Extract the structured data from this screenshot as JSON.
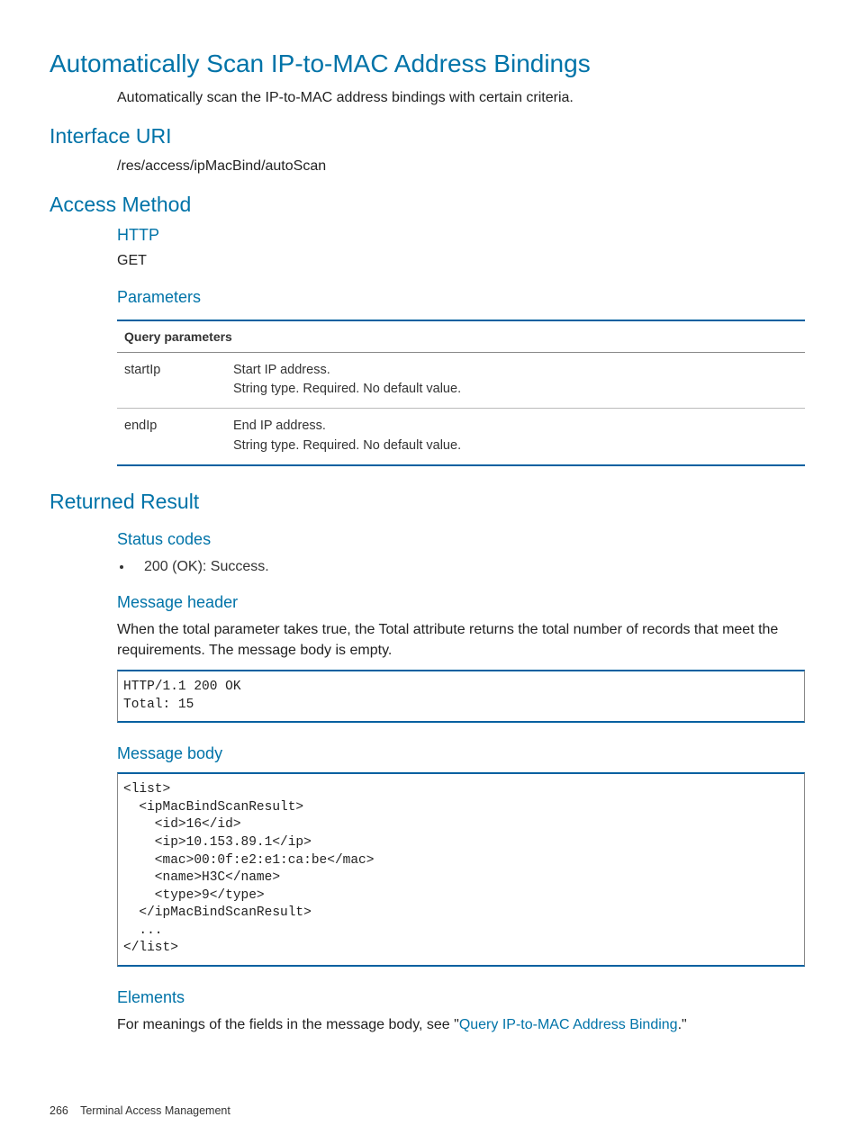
{
  "title": "Automatically Scan IP-to-MAC Address Bindings",
  "intro": "Automatically scan the IP-to-MAC address bindings with certain criteria.",
  "sections": {
    "interface_uri": {
      "heading": "Interface URI",
      "value": "/res/access/ipMacBind/autoScan"
    },
    "access_method": {
      "heading": "Access Method",
      "http_heading": "HTTP",
      "http_value": "GET",
      "parameters_heading": "Parameters",
      "table": {
        "header": "Query parameters",
        "rows": [
          {
            "name": "startIp",
            "line1": "Start IP address.",
            "line2": "String type. Required. No default value."
          },
          {
            "name": "endIp",
            "line1": "End IP address.",
            "line2": "String type. Required. No default value."
          }
        ]
      }
    },
    "returned_result": {
      "heading": "Returned Result",
      "status_codes_heading": "Status codes",
      "status_codes": [
        "200 (OK): Success."
      ],
      "message_header_heading": "Message header",
      "message_header_text": "When the total parameter takes true, the Total attribute returns the total number of records that meet the requirements. The message body is empty.",
      "message_header_code": "HTTP/1.1 200 OK\nTotal: 15",
      "message_body_heading": "Message body",
      "message_body_code": "<list>\n  <ipMacBindScanResult>\n    <id>16</id>\n    <ip>10.153.89.1</ip>\n    <mac>00:0f:e2:e1:ca:be</mac>\n    <name>H3C</name>\n    <type>9</type>\n  </ipMacBindScanResult>\n  ...\n</list>",
      "elements_heading": "Elements",
      "elements_prefix": "For meanings of the fields in the message body, see \"",
      "elements_link": "Query IP-to-MAC Address Binding",
      "elements_suffix": ".\""
    }
  },
  "footer": {
    "page": "266",
    "chapter": "Terminal Access Management"
  }
}
